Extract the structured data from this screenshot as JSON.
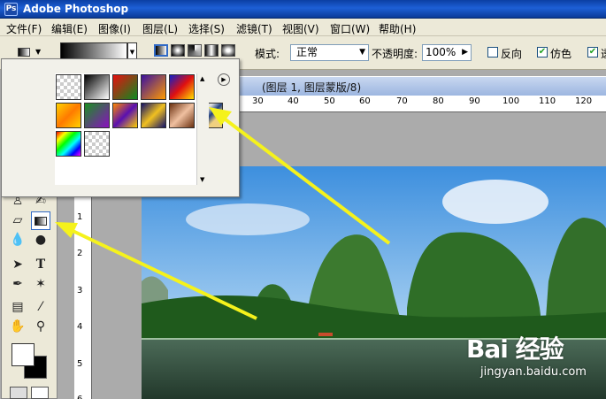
{
  "window": {
    "app_title": "Adobe Photoshop",
    "icon_letters": "Ps"
  },
  "menu": [
    "文件(F)",
    "编辑(E)",
    "图像(I)",
    "图层(L)",
    "选择(S)",
    "滤镜(T)",
    "视图(V)",
    "窗口(W)",
    "帮助(H)"
  ],
  "options_bar": {
    "mode_label": "模式:",
    "mode_value": "正常",
    "opacity_label": "不透明度:",
    "opacity_value": "100%",
    "reverse_label": "反向",
    "reverse_checked": false,
    "dither_label": "仿色",
    "dither_checked": true,
    "transparency_label": "透",
    "transparency_checked": true
  },
  "document": {
    "title": "(图层 1, 图层蒙版/8)",
    "h_ruler_labels": [
      "30",
      "40",
      "50",
      "60",
      "70",
      "80",
      "90",
      "100",
      "110",
      "120"
    ],
    "v_ruler_labels": [
      "1",
      "2",
      "3",
      "4",
      "5",
      "6"
    ]
  },
  "gradient_picker": {
    "icon_colors": [
      "accent:#316ac5"
    ],
    "swatches": [
      {
        "name": "transparent"
      },
      {
        "name": "black-white",
        "colors": [
          "#000000",
          "#ffffff"
        ]
      },
      {
        "name": "red-green",
        "colors": [
          "#e81010",
          "#0b8a1f"
        ]
      },
      {
        "name": "violet-orange",
        "colors": [
          "#3a10a0",
          "#ff9a00"
        ]
      },
      {
        "name": "blue-red-yellow",
        "colors": [
          "#1020c8",
          "#e01010",
          "#ffe000"
        ]
      },
      {
        "name": "yellow-orange",
        "colors": [
          "#ffd200",
          "#ff7a00",
          "#ffd200"
        ]
      },
      {
        "name": "green-violet",
        "colors": [
          "#1a9020",
          "#8a10c0"
        ]
      },
      {
        "name": "orange-violet-gold",
        "colors": [
          "#ff8800",
          "#5a10b0",
          "#ffd000"
        ]
      },
      {
        "name": "navy-gold",
        "colors": [
          "#10106a",
          "#f0c020",
          "#10106a"
        ]
      },
      {
        "name": "copper",
        "colors": [
          "#6a3010",
          "#f0c0a0",
          "#6a3010"
        ]
      },
      {
        "name": "chrome",
        "colors": [
          "#e0e0e0",
          "#204080",
          "#f0d080"
        ]
      },
      {
        "name": "spectrum",
        "colors": [
          "#ff0000",
          "#ffff00",
          "#00ff00",
          "#00ffff",
          "#0000ff",
          "#ff00ff"
        ]
      },
      {
        "name": "transparent-rainbow"
      }
    ]
  },
  "colors": {
    "fg": "#ffffff",
    "bg": "#000000",
    "titlebar": "#0b3fa3",
    "annotation_arrow": "#f5f21c"
  },
  "watermark": {
    "brand": "Bai 经验",
    "url": "jingyan.baidu.com"
  }
}
